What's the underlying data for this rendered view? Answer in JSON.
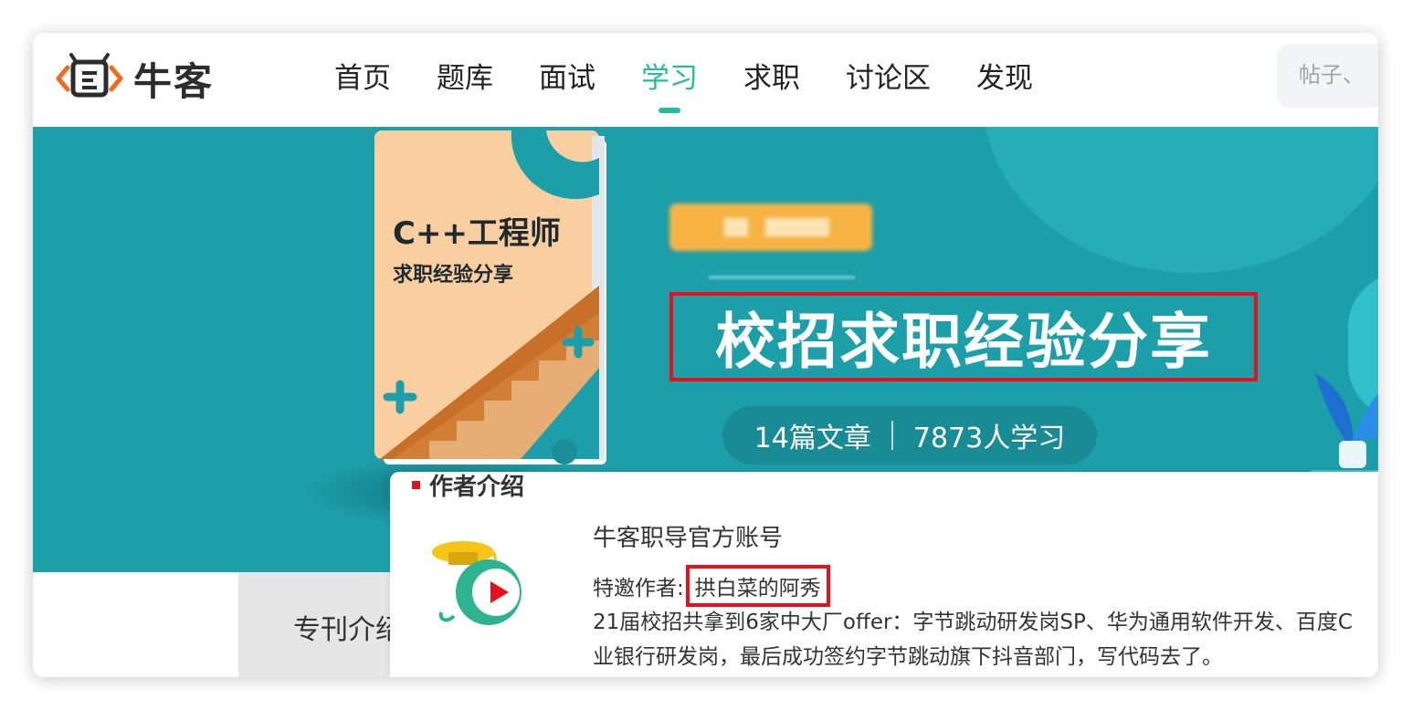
{
  "header": {
    "logo_text": "牛客",
    "nav": [
      "首页",
      "题库",
      "面试",
      "学习",
      "求职",
      "讨论区",
      "发现"
    ],
    "active_nav": "学习",
    "search_placeholder": "帖子、"
  },
  "banner": {
    "book_title": "C++工程师",
    "book_subtitle": "求职经验分享",
    "title": "校招求职经验分享",
    "articles": "14篇文章",
    "learners": "7873人学习"
  },
  "content": {
    "intro_tab": "专刊介绍"
  },
  "author": {
    "heading": "作者介绍",
    "name": "牛客职导官方账号",
    "guest_label": "特邀作者:",
    "guest_name": "拱白菜的阿秀",
    "description": "21届校招共拿到6家中大厂offer：字节跳动研发岗SP、华为通用软件开发、百度C",
    "description2": "业银行研发岗，最后成功签约字节跳动旗下抖音部门，写代码去了。"
  },
  "colors": {
    "accent": "#25bb9b",
    "banner": "#1d9faa",
    "highlight_box": "#e8101a",
    "book": "#f9cfa1"
  }
}
